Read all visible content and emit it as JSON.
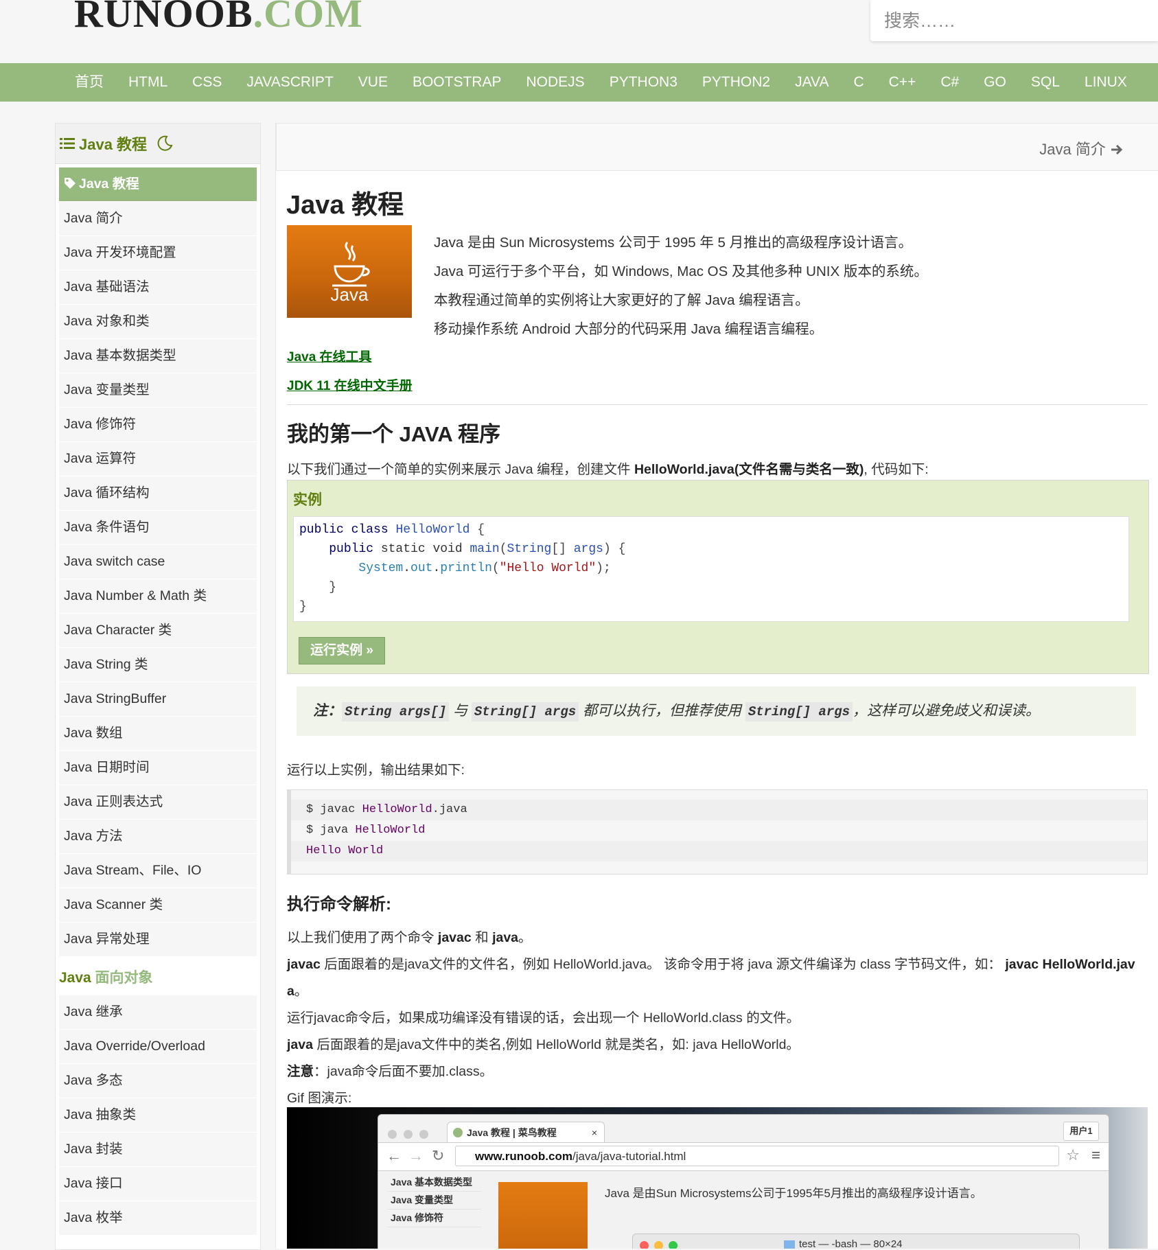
{
  "header": {
    "logo_main": "RUNOOB",
    "logo_dot": ".COM",
    "search_placeholder": "搜索……"
  },
  "nav": [
    "首页",
    "HTML",
    "CSS",
    "JAVASCRIPT",
    "VUE",
    "BOOTSTRAP",
    "NODEJS",
    "PYTHON3",
    "PYTHON2",
    "JAVA",
    "C",
    "C++",
    "C#",
    "GO",
    "SQL",
    "LINUX"
  ],
  "sidebar": {
    "title": "Java 教程",
    "items": [
      "Java 教程",
      "Java 简介",
      "Java 开发环境配置",
      "Java 基础语法",
      "Java 对象和类",
      "Java 基本数据类型",
      "Java 变量类型",
      "Java 修饰符",
      "Java 运算符",
      "Java 循环结构",
      "Java 条件语句",
      "Java switch case",
      "Java Number & Math 类",
      "Java Character 类",
      "Java String 类",
      "Java StringBuffer",
      "Java 数组",
      "Java 日期时间",
      "Java 正则表达式",
      "Java 方法",
      "Java Stream、File、IO",
      "Java Scanner 类",
      "Java 异常处理"
    ],
    "section2_prefix": "Java",
    "section2_rest": " 面向对象",
    "items2": [
      "Java 继承",
      "Java Override/Overload",
      "Java 多态",
      "Java 抽象类",
      "Java 封装",
      "Java 接口",
      "Java 枚举"
    ]
  },
  "main": {
    "next_link": "Java 简介",
    "title": "Java 教程",
    "logo_text": "Java",
    "intro": [
      "Java 是由 Sun Microsystems 公司于 1995 年 5 月推出的高级程序设计语言。",
      "Java 可运行于多个平台，如 Windows, Mac OS 及其他多种 UNIX 版本的系统。",
      "本教程通过简单的实例将让大家更好的了解 Java 编程语言。",
      "移动操作系统 Android 大部分的代码采用 Java 编程语言编程。"
    ],
    "link1": "Java 在线工具",
    "link2": "JDK 11 在线中文手册",
    "h2": "我的第一个 JAVA 程序",
    "p1_a": "以下我们通过一个简单的实例来展示 Java 编程，创建文件 ",
    "p1_b": "HelloWorld.java(文件名需与类名一致)",
    "p1_c": ", 代码如下:",
    "example_title": "实例",
    "run_button": "运行实例 »",
    "note": {
      "label": "注：",
      "code1": "String args[]",
      "mid1": " 与 ",
      "code2": "String[] args",
      "mid2": " 都可以执行，但推荐使用 ",
      "code3": "String[] args",
      "end": "，这样可以避免歧义和误读。"
    },
    "p2": "运行以上实例，输出结果如下:",
    "terminal": {
      "l1a": "$ javac ",
      "l1b": "HelloWorld",
      "l1c": ".java",
      "l2a": "$ java ",
      "l2b": "HelloWorld",
      "l3": "Hello World"
    },
    "h3": "执行命令解析:",
    "exp": {
      "l1a": "以上我们使用了两个命令 ",
      "l1b": "javac",
      "l1c": " 和 ",
      "l1d": "java",
      "l1e": "。",
      "l2a": "javac",
      "l2b": " 后面跟着的是java文件的文件名，例如 HelloWorld.java。 该命令用于将 java 源文件编译为 class 字节码文件，如：",
      "l2c": "javac HelloWorld.jav",
      "l2d": "a",
      "l2e": "。",
      "l3": "运行javac命令后，如果成功编译没有错误的话，会出现一个 HelloWorld.class 的文件。",
      "l4a": "java",
      "l4b": " 后面跟着的是java文件中的类名,例如 HelloWorld 就是类名，如: java HelloWorld。",
      "l5a": "注意",
      "l5b": "：java命令后面不要加.class。",
      "l6": "Gif 图演示:"
    },
    "gif": {
      "tab": "Java 教程 | 菜鸟教程",
      "user": "用户1",
      "url_host": "www.runoob.com",
      "url_path": "/java/java-tutorial.html",
      "side": [
        "Java 基本数据类型",
        "Java 变量类型",
        "Java 修饰符"
      ],
      "text": "Java 是由Sun Microsystems公司于1995年5月推出的高级程序设计语言。",
      "terminal_title": "test — -bash — 80×24"
    }
  }
}
